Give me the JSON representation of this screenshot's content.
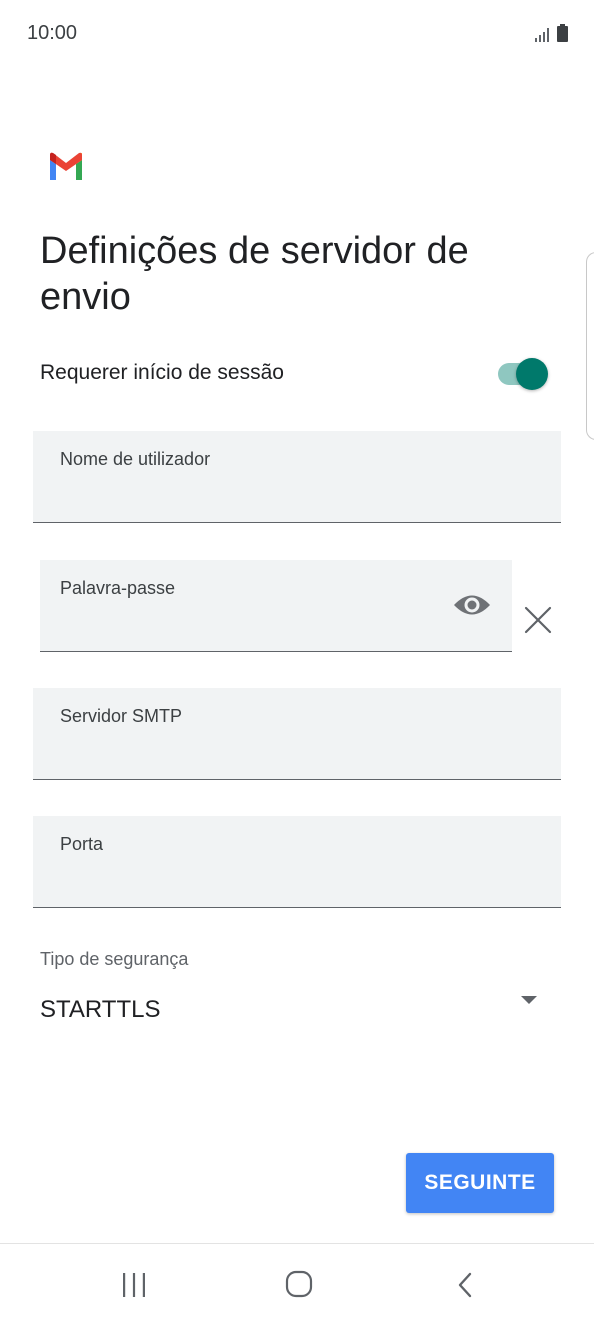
{
  "status_bar": {
    "time": "10:00",
    "icons": [
      "signal-icon",
      "battery-icon"
    ]
  },
  "app": {
    "logo_icon": "gmail-logo"
  },
  "page": {
    "title": "Definições de servidor de envio"
  },
  "require_signin": {
    "label": "Requerer início de sessão",
    "enabled": true
  },
  "fields": {
    "username": {
      "label": "Nome de utilizador",
      "value": ""
    },
    "password": {
      "label": "Palavra-passe",
      "value": ""
    },
    "smtp_server": {
      "label": "Servidor SMTP",
      "value": ""
    },
    "port": {
      "label": "Porta",
      "value": ""
    }
  },
  "security": {
    "label": "Tipo de segurança",
    "value": "STARTTLS"
  },
  "actions": {
    "next_label": "SEGUINTE"
  },
  "nav_bar": {
    "icons": [
      "recent-apps-icon",
      "home-icon",
      "back-icon"
    ]
  },
  "colors": {
    "accent_teal": "#00796b",
    "button_blue": "#4285f4",
    "field_background": "#f1f3f4"
  }
}
